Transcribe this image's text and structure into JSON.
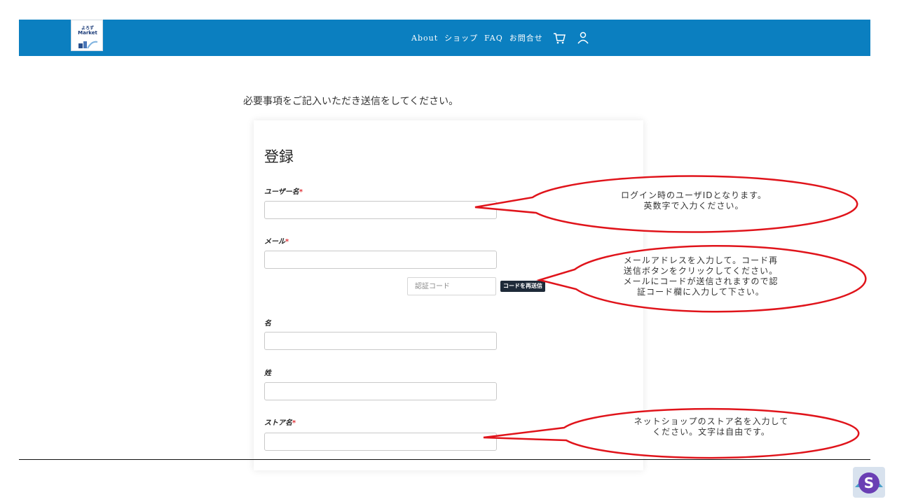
{
  "header": {
    "logo": {
      "top": "よろず",
      "text": "Market"
    },
    "nav": [
      {
        "label": "About"
      },
      {
        "label": "ショップ"
      },
      {
        "label": "FAQ"
      },
      {
        "label": "お問合せ"
      }
    ],
    "icons": {
      "cart": "cart-icon",
      "account": "user-icon"
    },
    "bg_color": "#0b7fc0"
  },
  "intro": "必要事項をご記入いただき送信をしてください。",
  "form": {
    "title": "登録",
    "fields": {
      "username": {
        "label": "ユーザー名",
        "required": "*",
        "value": ""
      },
      "email": {
        "label": "メール",
        "required": "*",
        "value": ""
      },
      "first_name": {
        "label": "名",
        "value": ""
      },
      "last_name": {
        "label": "姓",
        "value": ""
      },
      "store_name": {
        "label": "ストア名",
        "required": "*",
        "value": ""
      }
    },
    "verification_code": {
      "placeholder": "認証コード",
      "value": ""
    },
    "resend_button": "コードを再送信"
  },
  "callouts": [
    {
      "lines": [
        "ログイン時のユーザIDとなります。",
        "英数字で入力ください。"
      ]
    },
    {
      "lines": [
        "メールアドレスを入力して。コード再",
        "送信ボタンをクリックしてください。",
        "メールにコードが送信されますので認",
        "証コード欄に入力して下さい。"
      ]
    },
    {
      "lines": [
        "ネットショップのストア名を入力して",
        "ください。文字は自由です。"
      ]
    }
  ],
  "colors": {
    "callout_stroke": "#e0141b",
    "required": "#e0363b",
    "button": "#1e2a38"
  }
}
